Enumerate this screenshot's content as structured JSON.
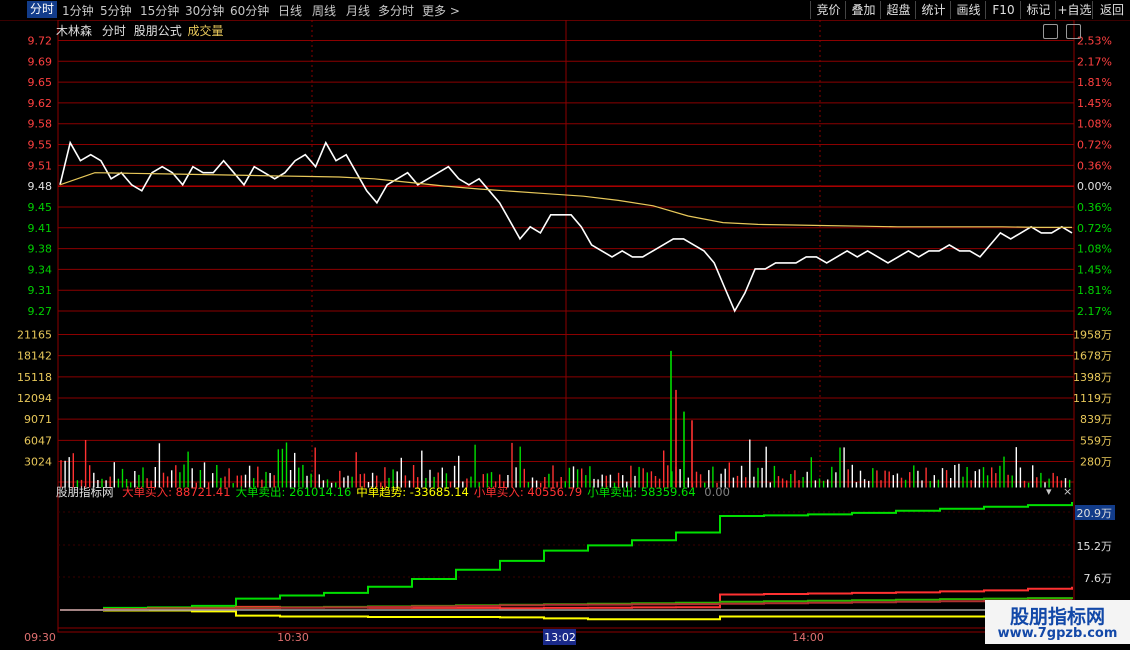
{
  "toolbar": {
    "left": [
      "分时",
      "1分钟",
      "5分钟",
      "15分钟",
      "30分钟",
      "60分钟",
      "日线",
      "周线",
      "月线",
      "多分时",
      "更多 >"
    ],
    "right": [
      "竞价",
      "叠加",
      "超盘",
      "统计",
      "画线",
      "F10",
      "标记",
      "+自选",
      "返回"
    ]
  },
  "header": {
    "name": "木林森",
    "mode": "分时",
    "formula": "股朋公式",
    "indicator": "成交量"
  },
  "price_axis": {
    "left": [
      "9.72",
      "9.69",
      "9.65",
      "9.62",
      "9.58",
      "9.55",
      "9.51",
      "9.48",
      "9.45",
      "9.41",
      "9.38",
      "9.34",
      "9.31",
      "9.27"
    ],
    "right": [
      "2.53%",
      "2.17%",
      "1.81%",
      "1.45%",
      "1.08%",
      "0.72%",
      "0.36%",
      "0.00%",
      "0.36%",
      "0.72%",
      "1.08%",
      "1.45%",
      "1.81%",
      "2.17%"
    ]
  },
  "volume_axis": {
    "left": [
      "21165",
      "18142",
      "15118",
      "12094",
      "9071",
      "6047",
      "3024"
    ],
    "right": [
      "1958万",
      "1678万",
      "1398万",
      "1119万",
      "839万",
      "559万",
      "280万"
    ]
  },
  "indicator_panel": {
    "title": "股朋指标网",
    "items": [
      {
        "label": "大单买入:",
        "value": "88721.41",
        "color": "#ff3232"
      },
      {
        "label": "大单卖出:",
        "value": "261014.16",
        "color": "#00e000"
      },
      {
        "label": "中单趋势:",
        "value": "-33685.14",
        "color": "#ffff00"
      },
      {
        "label": "小单买入:",
        "value": "40556.79",
        "color": "#ff3232"
      },
      {
        "label": "小单卖出:",
        "value": "58359.64",
        "color": "#00e000"
      },
      {
        "label": "",
        "value": "0.00",
        "color": "#808080"
      }
    ],
    "axis": [
      "20.9万",
      "15.2万",
      "7.6万"
    ]
  },
  "time_axis": [
    "09:30",
    "10:30",
    "13:02",
    "14:00"
  ],
  "watermark": {
    "title": "股朋指标网",
    "url": "www.7gpzb.com"
  },
  "chart_data": {
    "type": "line",
    "title": "木林森 分时",
    "price_ylim": [
      9.27,
      9.72
    ],
    "prev_close": 9.48,
    "price": [
      9.48,
      9.55,
      9.52,
      9.53,
      9.52,
      9.49,
      9.5,
      9.48,
      9.47,
      9.5,
      9.51,
      9.5,
      9.48,
      9.51,
      9.5,
      9.5,
      9.52,
      9.5,
      9.48,
      9.51,
      9.5,
      9.49,
      9.5,
      9.52,
      9.53,
      9.51,
      9.55,
      9.52,
      9.53,
      9.5,
      9.47,
      9.45,
      9.48,
      9.49,
      9.5,
      9.48,
      9.49,
      9.5,
      9.51,
      9.49,
      9.48,
      9.49,
      9.47,
      9.45,
      9.42,
      9.39,
      9.41,
      9.4,
      9.43,
      9.43,
      9.43,
      9.41,
      9.38,
      9.37,
      9.36,
      9.37,
      9.36,
      9.36,
      9.37,
      9.38,
      9.39,
      9.39,
      9.38,
      9.37,
      9.35,
      9.31,
      9.27,
      9.3,
      9.34,
      9.34,
      9.35,
      9.35,
      9.35,
      9.36,
      9.36,
      9.35,
      9.36,
      9.37,
      9.36,
      9.37,
      9.36,
      9.35,
      9.36,
      9.37,
      9.36,
      9.37,
      9.37,
      9.38,
      9.37,
      9.37,
      9.36,
      9.38,
      9.4,
      9.39,
      9.4,
      9.41,
      9.4,
      9.4,
      9.41,
      9.4
    ],
    "avg_price": [
      9.48,
      9.5,
      9.499,
      9.498,
      9.497,
      9.496,
      9.495,
      9.494,
      9.493,
      9.49,
      9.484,
      9.478,
      9.473,
      9.469,
      9.465,
      9.461,
      9.454,
      9.445,
      9.428,
      9.417,
      9.414,
      9.413,
      9.412,
      9.411,
      9.41,
      9.41,
      9.41,
      9.41,
      9.409,
      9.409
    ],
    "volume_ylim": [
      0,
      21165
    ],
    "volume_series": [
      {
        "name": "up",
        "color": "#ff3232"
      },
      {
        "name": "down",
        "color": "#00e000"
      },
      {
        "name": "flat",
        "color": "#ffffff"
      }
    ],
    "volume_peaks": [
      {
        "time": "14:00",
        "values": [
          18900,
          13500,
          10500,
          9300
        ]
      }
    ],
    "indicator_ylim": [
      0,
      209000
    ],
    "indicator_series": [
      {
        "name": "大单卖出",
        "color": "#00e000",
        "values": [
          0,
          4000,
          5000,
          8000,
          22000,
          28000,
          33000,
          45000,
          60000,
          78000,
          95000,
          115000,
          125000,
          135000,
          150000,
          182000,
          183000,
          185000,
          188000,
          192000,
          196000,
          200000,
          203000,
          209000
        ]
      },
      {
        "name": "大单买入",
        "color": "#ff3232",
        "values": [
          0,
          2000,
          3000,
          4000,
          6000,
          5000,
          5000,
          4500,
          4000,
          4000,
          3500,
          4000,
          4500,
          5000,
          5500,
          30000,
          31000,
          32000,
          33000,
          34000,
          36000,
          38000,
          41000,
          45000
        ]
      },
      {
        "name": "中单趋势",
        "color": "#ffff00",
        "values": [
          0,
          -1000,
          -1000,
          -3000,
          -12000,
          -14000,
          -14000,
          -15000,
          -15000,
          -15000,
          -16000,
          -18000,
          -20000,
          -20000,
          -20000,
          -14000,
          -14000,
          -14000,
          -14000,
          -14000,
          -14000,
          -14000,
          -14000,
          -14000
        ]
      },
      {
        "name": "小单卖出",
        "color": "#2db300",
        "values": [
          0,
          1000,
          2000,
          3000,
          4000,
          5000,
          6000,
          7000,
          8000,
          9000,
          10000,
          11000,
          12000,
          13000,
          14000,
          16000,
          17000,
          18000,
          19000,
          20000,
          21000,
          22000,
          23000,
          25000
        ]
      },
      {
        "name": "小单买入",
        "color": "#b03030",
        "values": [
          0,
          500,
          1500,
          2500,
          3500,
          4500,
          5000,
          6000,
          7000,
          8000,
          9000,
          10000,
          10500,
          11000,
          11500,
          12000,
          13000,
          14000,
          15000,
          16000,
          17000,
          18000,
          19000,
          20000
        ]
      }
    ]
  }
}
